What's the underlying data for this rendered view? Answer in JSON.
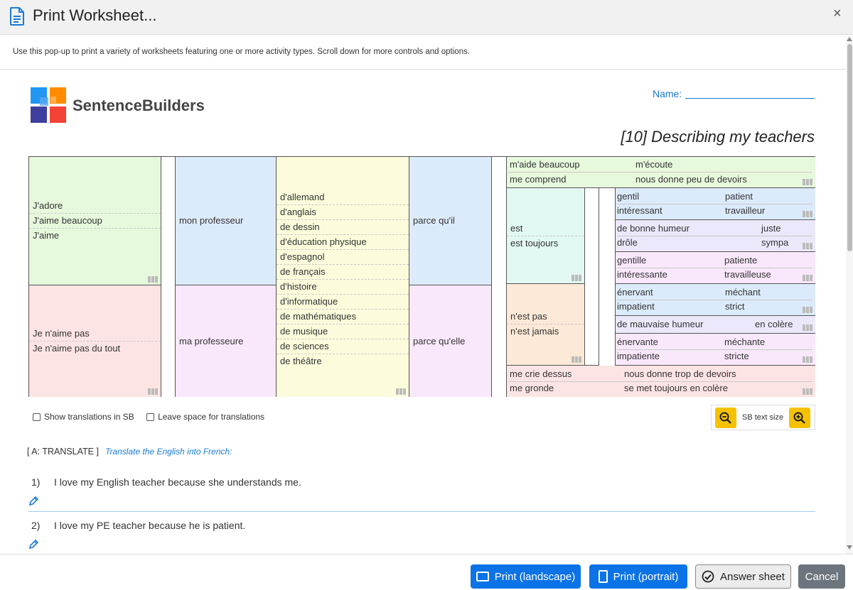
{
  "modal": {
    "title": "Print Worksheet...",
    "close": "×",
    "info": "Use this pop-up to print a variety of worksheets featuring one or more activity types. Scroll down for more controls and options."
  },
  "header": {
    "logo_text": "SentenceBuilders",
    "name_label": "Name:",
    "sheet_title": "[10] Describing my teachers"
  },
  "grid": {
    "col1_positive": [
      "J'adore",
      "J'aime beaucoup",
      "J'aime"
    ],
    "col1_negative": [
      "Je n'aime pas",
      "Je n'aime pas du tout"
    ],
    "col2_masc": "mon professeur",
    "col2_fem": "ma professeure",
    "col3_subjects": [
      "d'allemand",
      "d'anglais",
      "de dessin",
      "d'éducation physique",
      "d'espagnol",
      "de français",
      "d'histoire",
      "d'informatique",
      "de mathématiques",
      "de musique",
      "de sciences",
      "de théâtre"
    ],
    "col4_masc": "parce qu'il",
    "col4_fem": "parce qu'elle",
    "verbs_positive": [
      "m'aide beaucoup",
      "m'écoute",
      "me comprend",
      "nous donne peu de devoirs"
    ],
    "est_positive": [
      "est",
      "est toujours"
    ],
    "est_negative": [
      "n'est pas",
      "n'est jamais"
    ],
    "adj_masc_pos": [
      "gentil",
      "patient",
      "intéressant",
      "travailleur"
    ],
    "adj_neutral_pos": [
      "de bonne humeur",
      "juste",
      "drôle",
      "sympa"
    ],
    "adj_fem_pos": [
      "gentille",
      "patiente",
      "intéressante",
      "travailleuse"
    ],
    "adj_masc_neg": [
      "énervant",
      "méchant",
      "impatient",
      "strict"
    ],
    "adj_neutral_neg": [
      "de mauvaise humeur",
      "en colère"
    ],
    "adj_fem_neg": [
      "énervante",
      "méchante",
      "impatiente",
      "stricte"
    ],
    "verbs_negative": [
      "me crie dessus",
      "nous donne trop de devoirs",
      "me gronde",
      "se met toujours en colère"
    ]
  },
  "options": {
    "show_translations": "Show translations in SB",
    "leave_space": "Leave space for translations",
    "text_size": "SB text size"
  },
  "section": {
    "heading": "[ A: TRANSLATE ]",
    "instruction": "Translate the English into French:",
    "questions": [
      {
        "num": "1)",
        "text": "I love my English teacher because she understands me."
      },
      {
        "num": "2)",
        "text": "I love my PE teacher because he is patient."
      }
    ]
  },
  "footer": {
    "print_landscape": "Print (landscape)",
    "print_portrait": "Print (portrait)",
    "answer_sheet": "Answer sheet",
    "cancel": "Cancel"
  },
  "colors": {
    "accent": "#0b73e6",
    "zoom": "#f6c200"
  }
}
